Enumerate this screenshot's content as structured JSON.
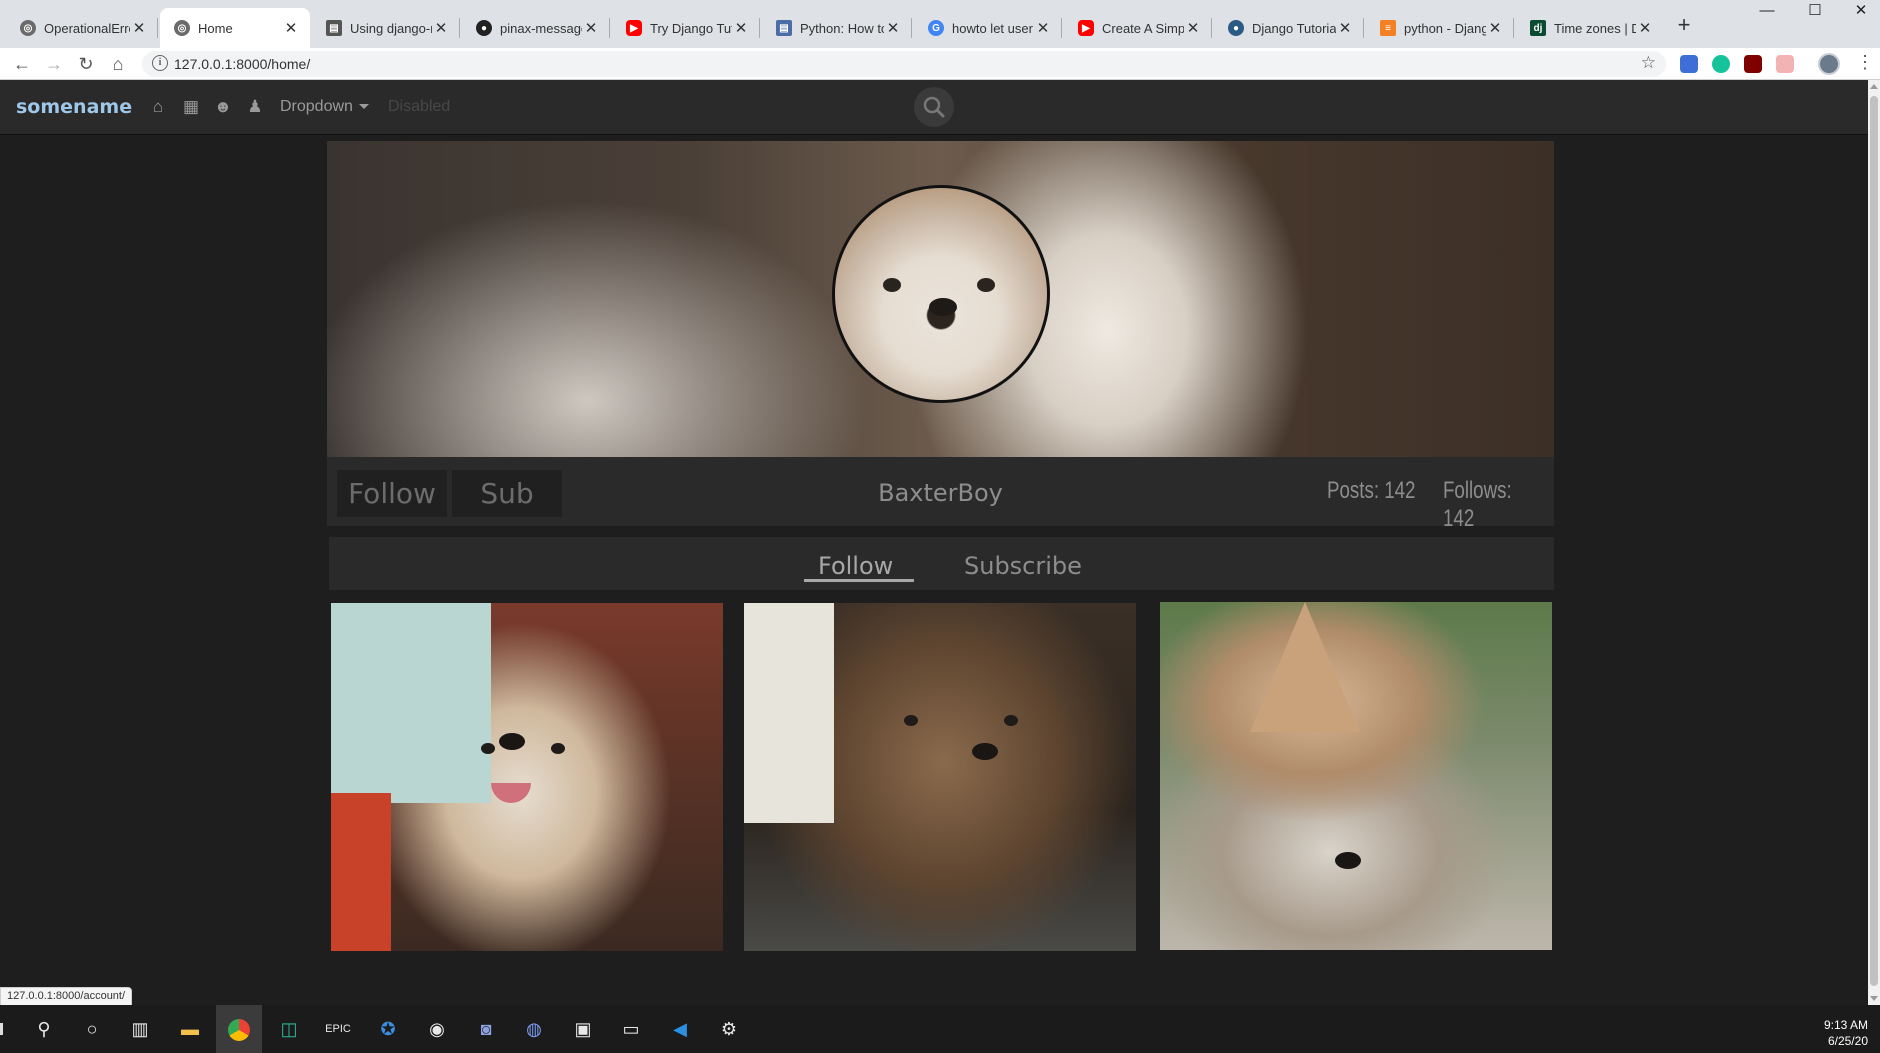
{
  "browser": {
    "tabs": [
      {
        "title": "OperationalError",
        "favicon": "globe-icon",
        "color": "#6b6b6b"
      },
      {
        "title": "Home",
        "favicon": "globe-icon",
        "color": "#6b6b6b",
        "active": true
      },
      {
        "title": "Using django-m",
        "favicon": "doc-icon",
        "color": "#555555"
      },
      {
        "title": "pinax-messages",
        "favicon": "github-icon",
        "color": "#222222"
      },
      {
        "title": "Try Django Tuto",
        "favicon": "youtube-icon",
        "color": "#ff0000"
      },
      {
        "title": "Python: How to",
        "favicon": "doc-icon",
        "color": "#4a6da7"
      },
      {
        "title": "howto let user",
        "favicon": "google-icon",
        "color": "#4285f4"
      },
      {
        "title": "Create A Simple",
        "favicon": "youtube-icon",
        "color": "#ff0000"
      },
      {
        "title": "Django Tutorial",
        "favicon": "bird-icon",
        "color": "#2b5b84"
      },
      {
        "title": "python - Djang",
        "favicon": "stackoverflow-icon",
        "color": "#f48024"
      },
      {
        "title": "Time zones | Dj",
        "favicon": "django-icon",
        "color": "#0c4b33"
      }
    ],
    "url": "127.0.0.1:8000/home/",
    "status_url": "127.0.0.1:8000/account/"
  },
  "site": {
    "brand": "somename",
    "nav": {
      "dropdown_label": "Dropdown",
      "disabled_label": "Disabled"
    }
  },
  "profile": {
    "username": "BaxterBoy",
    "follow_button": "Follow",
    "sub_button": "Sub",
    "posts_label": "Posts: 142",
    "follows_label": "Follows: 142",
    "tabs": {
      "follow": "Follow",
      "subscribe": "Subscribe"
    }
  },
  "taskbar": {
    "time": "9:13 AM",
    "date": "6/25/20"
  }
}
